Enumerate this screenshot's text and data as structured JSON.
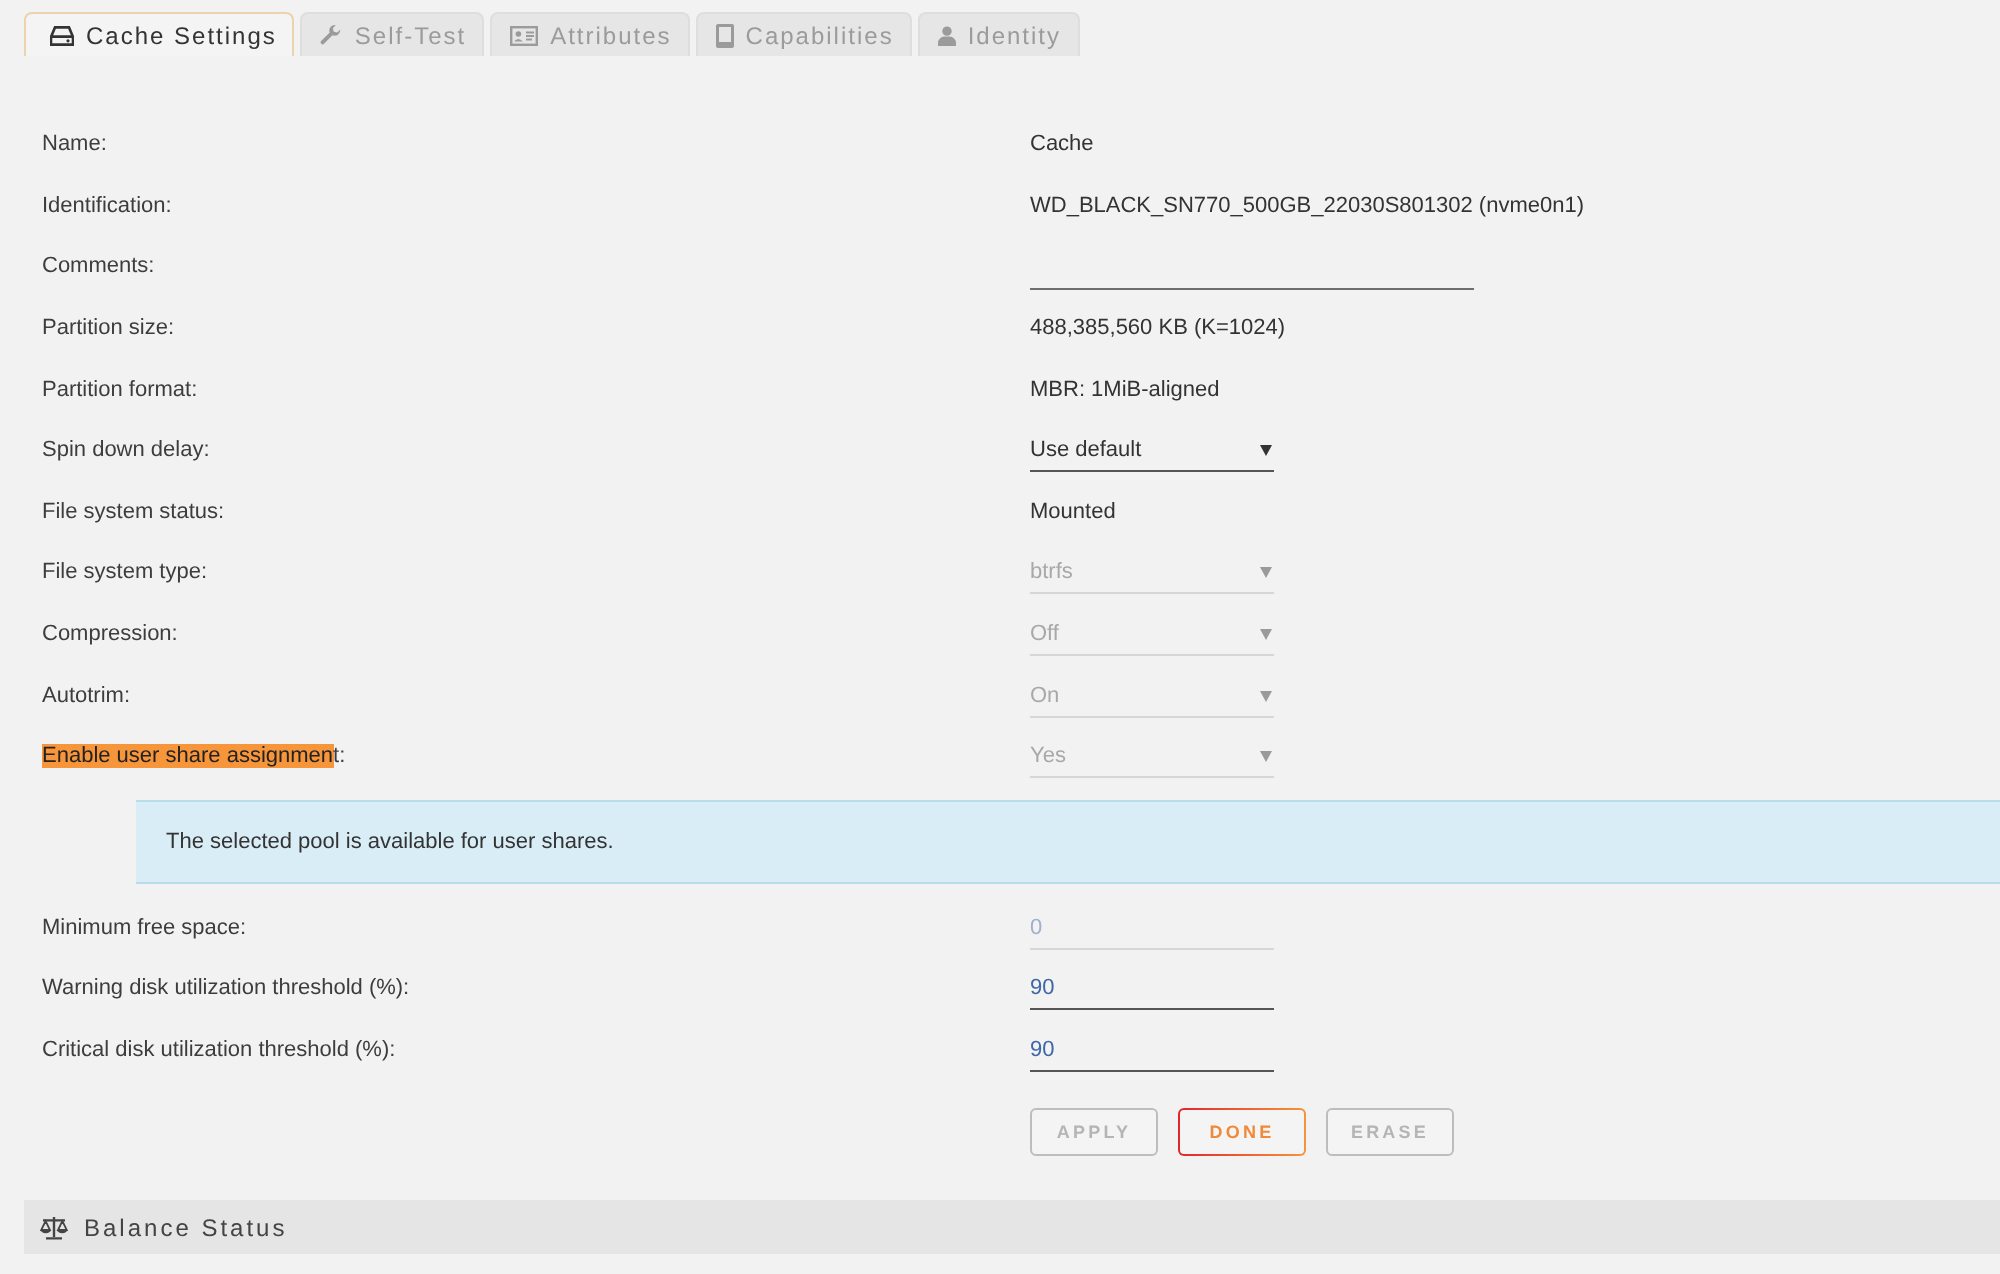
{
  "tabs": [
    {
      "label": "Cache Settings",
      "selected": true
    },
    {
      "label": "Self-Test",
      "selected": false
    },
    {
      "label": "Attributes",
      "selected": false
    },
    {
      "label": "Capabilities",
      "selected": false
    },
    {
      "label": "Identity",
      "selected": false
    }
  ],
  "settings": [
    {
      "kind": "text",
      "label": "Name:",
      "value": "Cache"
    },
    {
      "kind": "text",
      "label": "Identification:",
      "value": "WD_BLACK_SN770_500GB_22030S801302 (nvme0n1)"
    },
    {
      "kind": "input",
      "label": "Comments:"
    },
    {
      "kind": "text",
      "label": "Partition size:",
      "value": "488,385,560 KB (K=1024)"
    },
    {
      "kind": "text",
      "label": "Partition format:",
      "value": "MBR: 1MiB-aligned"
    },
    {
      "kind": "select",
      "label": "Spin down delay:",
      "value": "Use default",
      "disabled": false
    },
    {
      "kind": "text",
      "label": "File system status:",
      "value": "Mounted"
    },
    {
      "kind": "select",
      "label": "File system type:",
      "value": "btrfs",
      "disabled": true
    },
    {
      "kind": "select",
      "label": "Compression:",
      "value": "Off",
      "disabled": true
    },
    {
      "kind": "select",
      "label": "Autotrim:",
      "value": "On",
      "disabled": true
    },
    {
      "kind": "select",
      "label_parts": [
        {
          "text": "Enable user share assignmen",
          "highlighted": true
        },
        {
          "text": "t:",
          "highlighted": false
        }
      ],
      "value": "Yes",
      "disabled": true
    }
  ],
  "notice": {
    "text": "The selected pool is available for user shares."
  },
  "thresholds": [
    {
      "label": "Minimum free space:",
      "value": "0",
      "disabled": true
    },
    {
      "label": "Warning disk utilization threshold (%):",
      "value": "90",
      "disabled": false
    },
    {
      "label": "Critical disk utilization threshold (%):",
      "value": "90",
      "disabled": false
    }
  ],
  "buttons": [
    {
      "label": "APPLY",
      "disabled": true
    },
    {
      "label": "DONE",
      "disabled": false
    },
    {
      "label": "ERASE",
      "disabled": true
    }
  ],
  "section": {
    "title": "Balance Status"
  }
}
